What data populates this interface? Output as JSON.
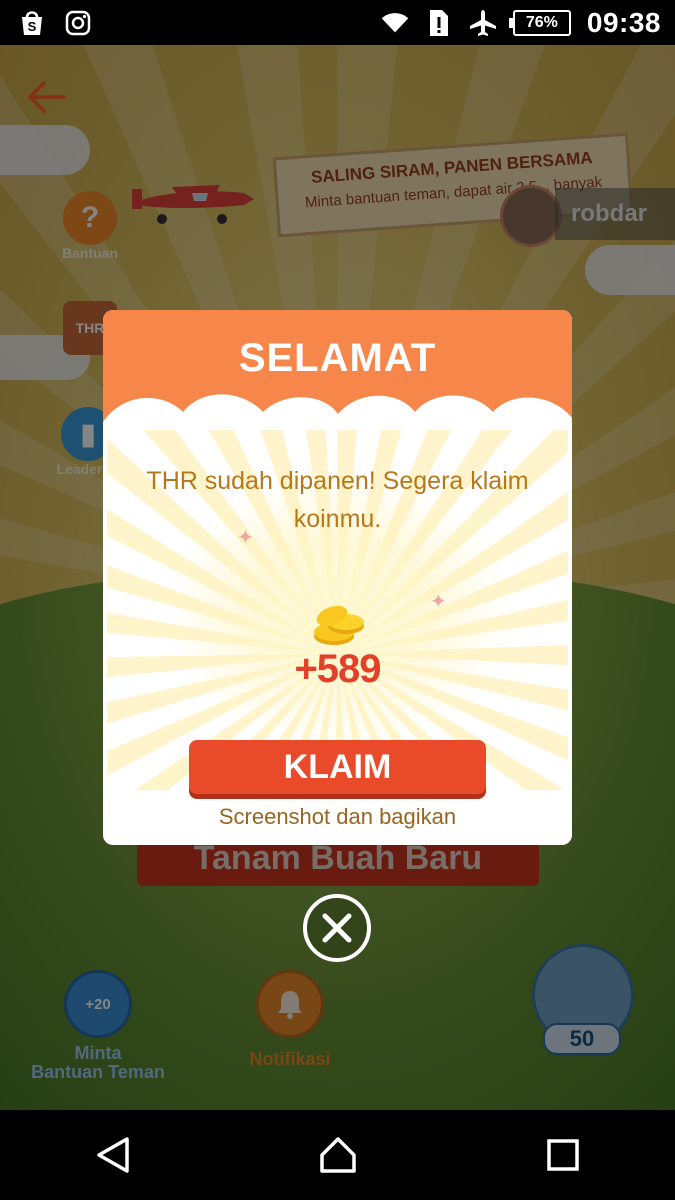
{
  "status_bar": {
    "battery": "76%",
    "time": "09:38",
    "icons": [
      "shopee-bag-icon",
      "instagram-icon",
      "wifi-icon",
      "sim-alert-icon",
      "airplane-icon",
      "battery-icon"
    ]
  },
  "game": {
    "banner_title": "SALING SIRAM, PANEN BERSAMA",
    "banner_sub": "Minta bantuan teman, dapat air 2,5... banyak",
    "friend_name": "robdar",
    "side_buttons": {
      "bantuan": "Bantuan",
      "thr": "THR",
      "leaderboard": "Leaderbo"
    },
    "background_button": "Tanam Buah Baru",
    "bottom": {
      "ask_friends_badge": "+20",
      "ask_friends_label_1": "Minta",
      "ask_friends_label_2": "Bantuan Teman",
      "notif_label": "Notifikasi",
      "water_count": "50"
    }
  },
  "modal": {
    "title": "SELAMAT",
    "message": "THR sudah dipanen! Segera klaim koinmu.",
    "coin_amount": "+589",
    "claim_label": "KLAIM",
    "share_text": "Screenshot dan bagikan"
  },
  "colors": {
    "modal_header": "#f7864a",
    "claim_button": "#e84a2a",
    "message_text": "#b8781a",
    "amount_text": "#e3402a"
  }
}
